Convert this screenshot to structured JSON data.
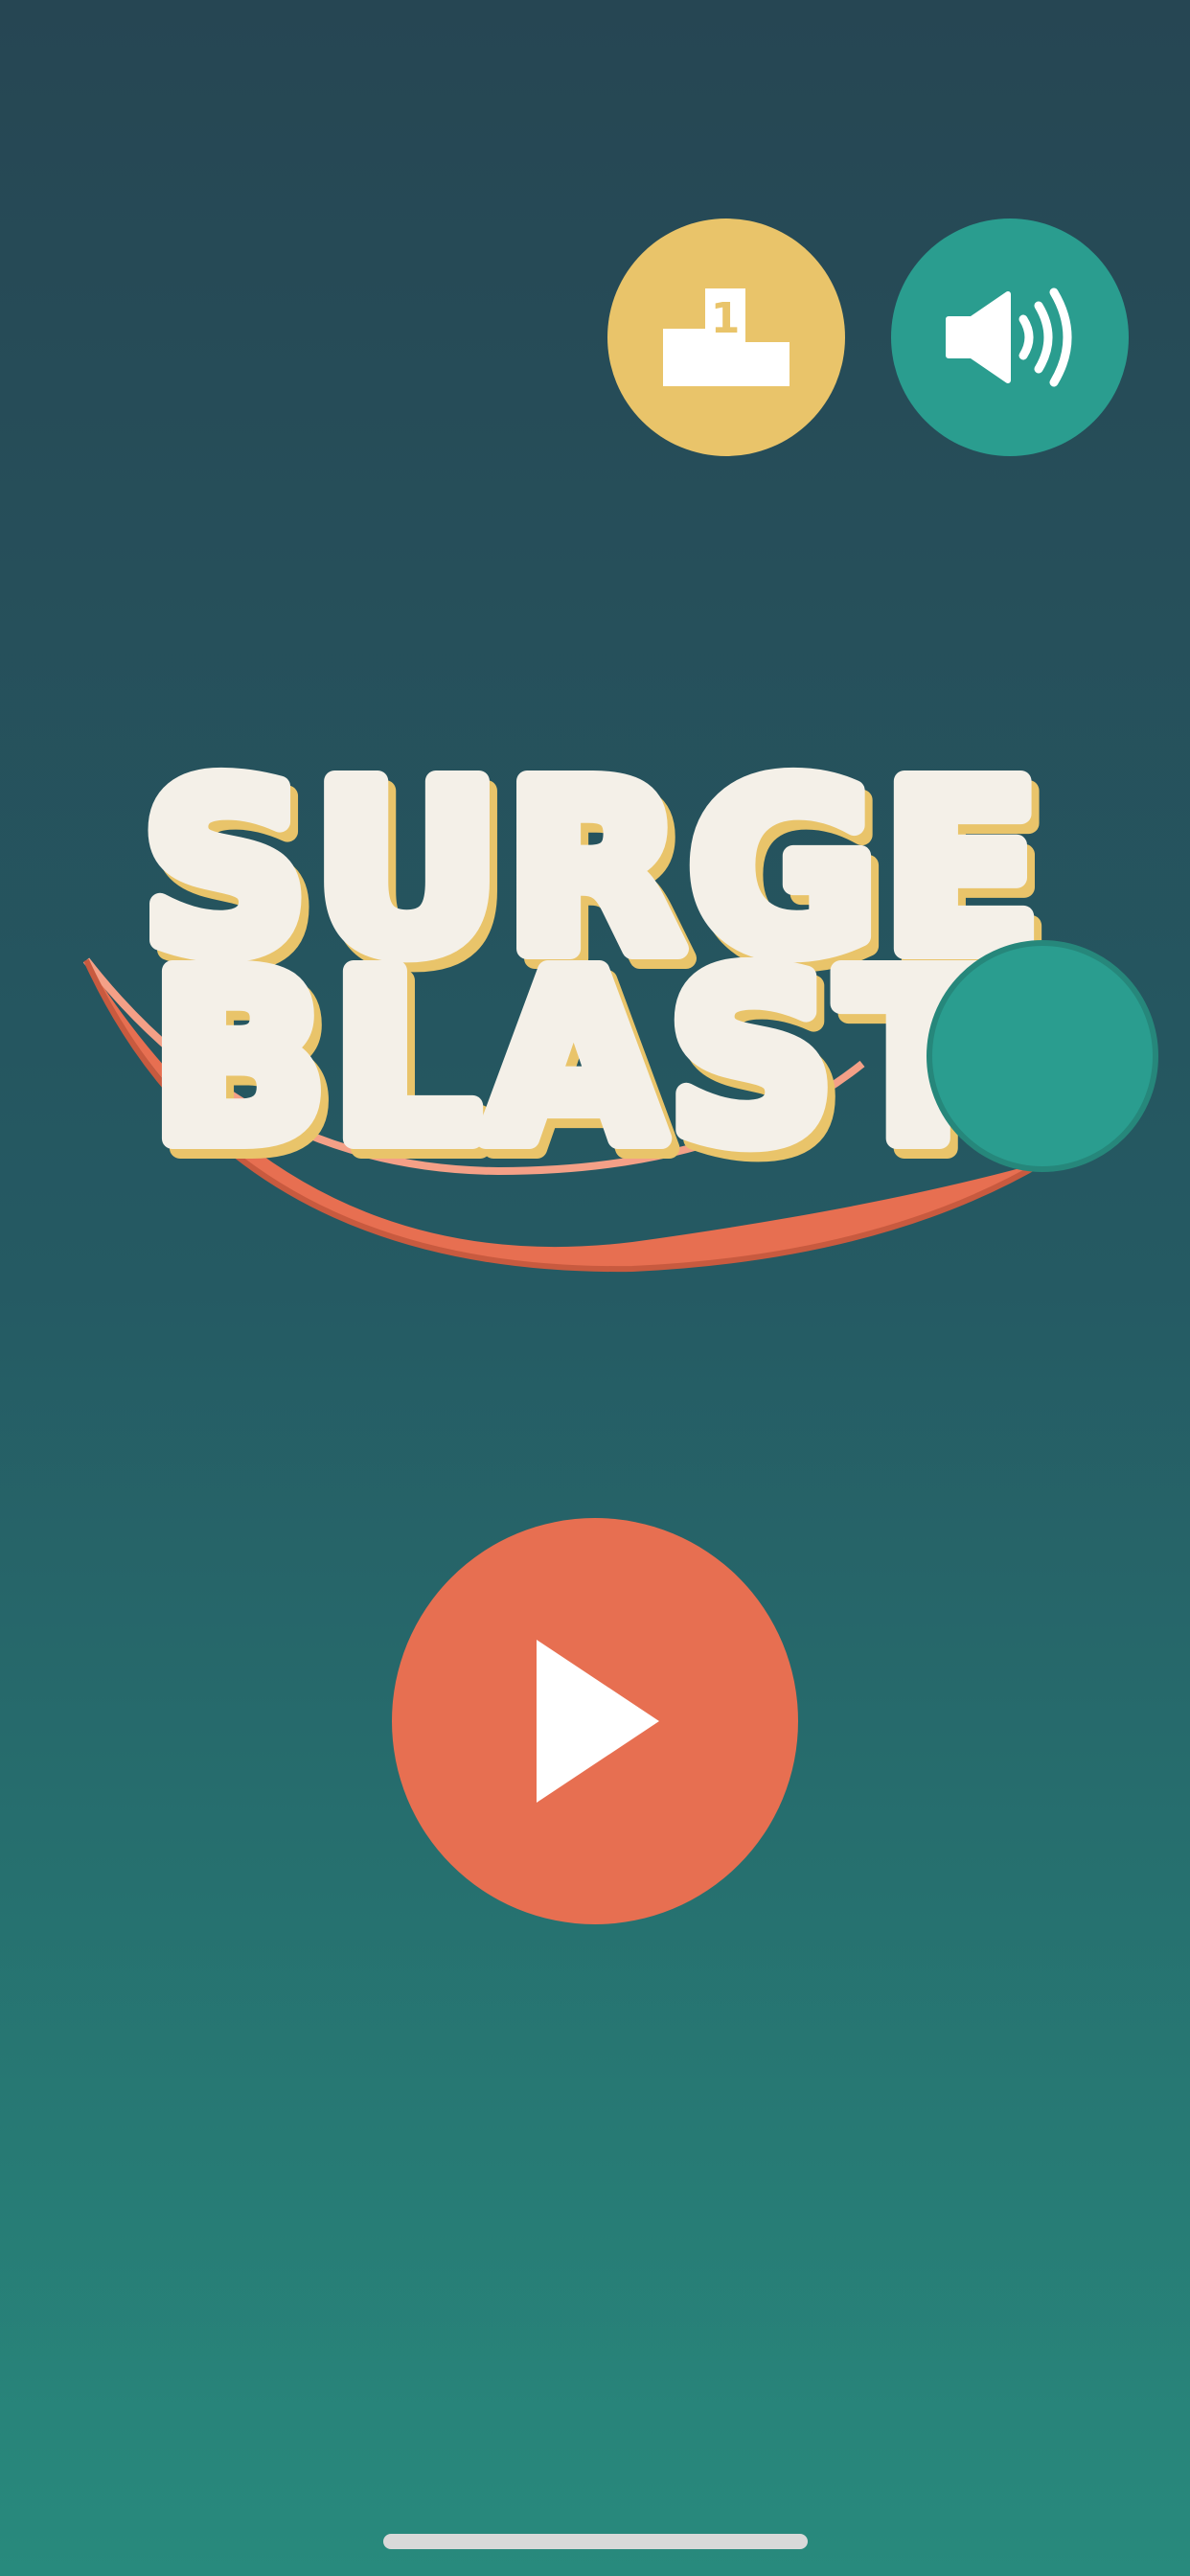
{
  "game": {
    "title_line1": "SURGE",
    "title_line2": "BLAST"
  },
  "buttons": {
    "leaderboard": {
      "icon": "podium-icon",
      "label": "1",
      "color": "#e9c46a"
    },
    "sound": {
      "icon": "speaker-icon",
      "color": "#2a9d8f"
    },
    "play": {
      "icon": "play-icon",
      "color": "#e76f51"
    }
  },
  "colors": {
    "background_top": "#264653",
    "background_bottom": "#288a7d",
    "title_fill": "#f4f0e8",
    "title_shadow": "#e9c46a",
    "swoosh": "#e76f51",
    "ball": "#2a9d8f"
  }
}
